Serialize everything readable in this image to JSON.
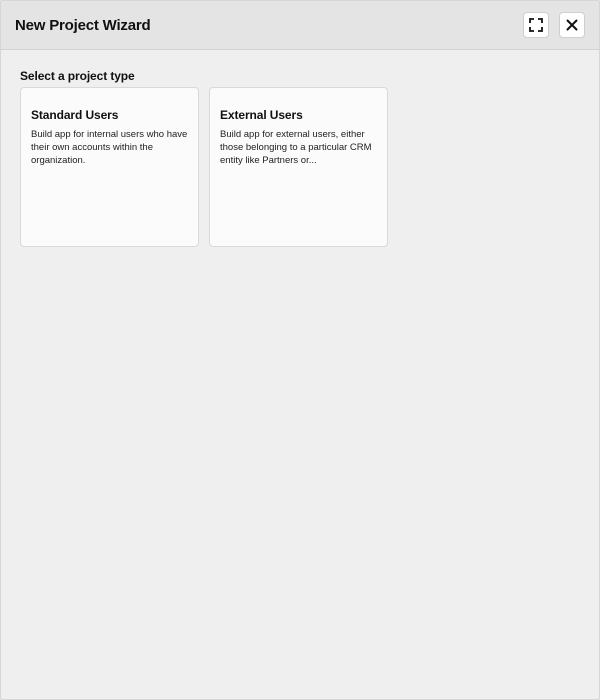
{
  "window": {
    "title": "New Project Wizard"
  },
  "header": {
    "maximize_icon": "expand-icon",
    "close_icon": "close-icon"
  },
  "main": {
    "section_label": "Select a project type",
    "cards": [
      {
        "title": "Standard Users",
        "description": "Build app for internal users who have their own accounts within the organization."
      },
      {
        "title": "External Users",
        "description": "Build app for external users, either those belonging to a particular CRM entity like Partners or..."
      }
    ]
  },
  "colors": {
    "header_bg": "#e4e4e4",
    "body_bg": "#efefef",
    "card_bg": "#fbfbfb",
    "text": "#111111"
  }
}
